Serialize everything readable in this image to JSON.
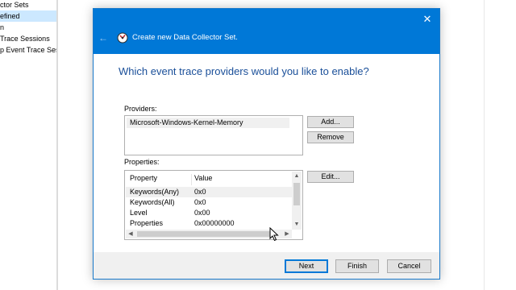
{
  "background": {
    "tree_items": [
      "ctor Sets",
      "efined",
      "n",
      "Trace Sessions",
      "p Event Trace Sess"
    ]
  },
  "dialog": {
    "title": "Create new Data Collector Set.",
    "question": "Which event trace providers would you like to enable?",
    "providers_label": "Providers:",
    "providers": [
      "Microsoft-Windows-Kernel-Memory"
    ],
    "add_label": "Add...",
    "remove_label": "Remove",
    "properties_label": "Properties:",
    "edit_label": "Edit...",
    "properties_columns": [
      "Property",
      "Value"
    ],
    "properties_rows": [
      {
        "property": "Keywords(Any)",
        "value": "0x0"
      },
      {
        "property": "Keywords(All)",
        "value": "0x0"
      },
      {
        "property": "Level",
        "value": "0x00"
      },
      {
        "property": "Properties",
        "value": "0x00000000"
      }
    ],
    "buttons": {
      "next": "Next",
      "finish": "Finish",
      "cancel": "Cancel"
    },
    "close_glyph": "✕",
    "back_glyph": "←",
    "scroll_glyphs": {
      "up": "▲",
      "down": "▼",
      "left": "◀",
      "right": "▶"
    }
  },
  "colors": {
    "titlebar": "#0078d7",
    "question_text": "#1a4f99",
    "selection": "#cce8ff"
  },
  "icons": [
    "close-icon",
    "back-arrow-icon",
    "data-collector-wizard-icon",
    "mouse-cursor-icon"
  ]
}
